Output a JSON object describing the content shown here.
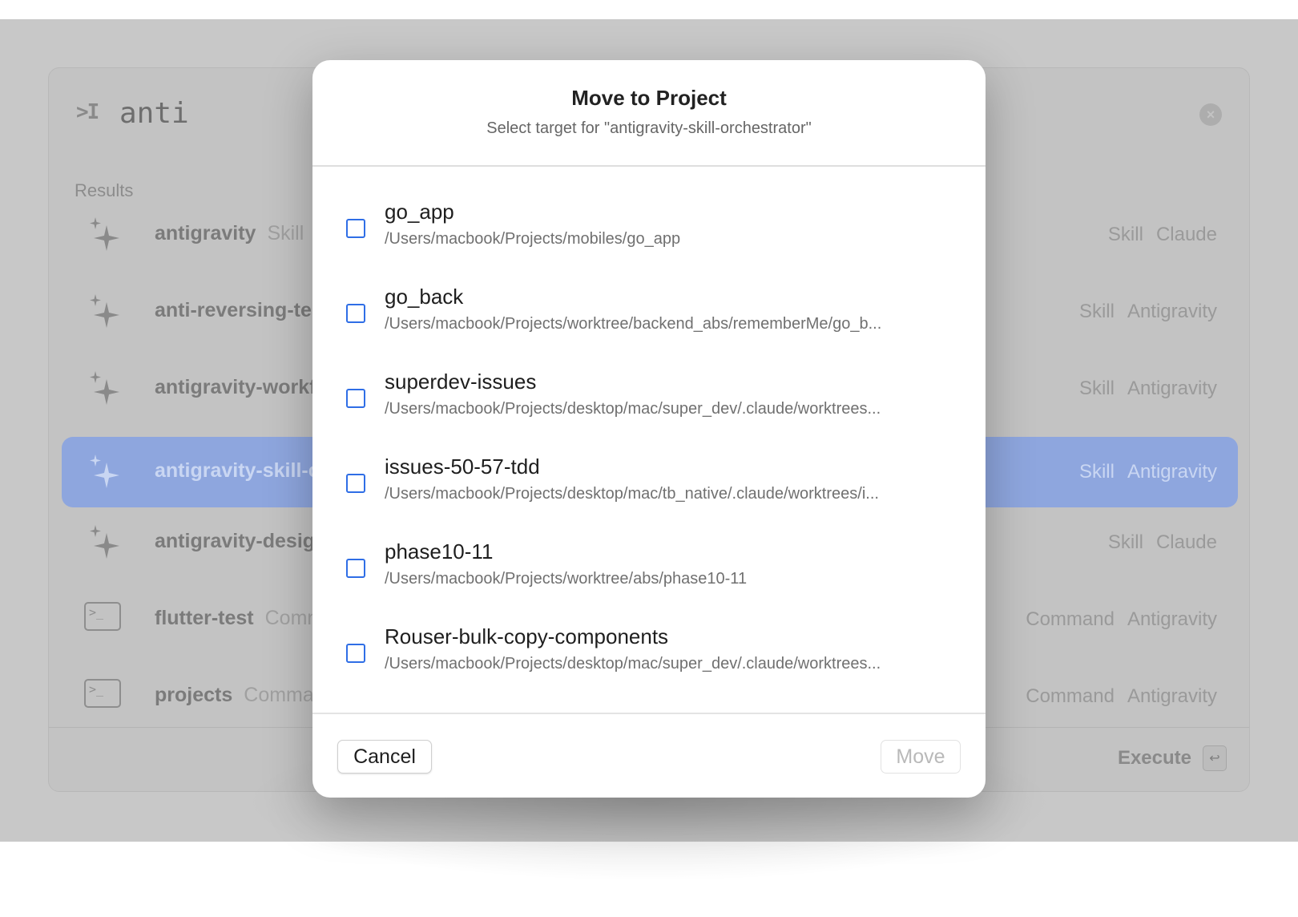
{
  "launcher": {
    "prompt_symbol": ">I",
    "query": "anti",
    "clear_symbol": "×",
    "results_label": "Results",
    "rows": [
      {
        "name": "antigravity",
        "kind": "Skill",
        "tag1": "Skill",
        "tag2": "Claude",
        "icon": "sparkle-icon",
        "selected": false
      },
      {
        "name": "anti-reversing-te",
        "kind": "",
        "tag1": "Skill",
        "tag2": "Antigravity",
        "icon": "sparkle-icon",
        "selected": false
      },
      {
        "name": "antigravity-workf",
        "kind": "",
        "tag1": "Skill",
        "tag2": "Antigravity",
        "icon": "sparkle-icon",
        "selected": false
      },
      {
        "name": "antigravity-skill-c",
        "kind": "",
        "tag1": "Skill",
        "tag2": "Antigravity",
        "icon": "sparkle-icon",
        "selected": true
      },
      {
        "name": "antigravity-desig",
        "kind": "",
        "tag1": "Skill",
        "tag2": "Claude",
        "icon": "sparkle-icon",
        "selected": false
      },
      {
        "name": "flutter-test",
        "kind": "Comn",
        "tag1": "Command",
        "tag2": "Antigravity",
        "icon": "terminal-icon",
        "selected": false
      },
      {
        "name": "projects",
        "kind": "Commar",
        "tag1": "Command",
        "tag2": "Antigravity",
        "icon": "terminal-icon",
        "selected": false
      }
    ],
    "execute_label": "Execute",
    "execute_key": "↩"
  },
  "modal": {
    "title": "Move to Project",
    "subtitle": "Select target for \"antigravity-skill-orchestrator\"",
    "projects": [
      {
        "name": "go_app",
        "path": "/Users/macbook/Projects/mobiles/go_app"
      },
      {
        "name": "go_back",
        "path": "/Users/macbook/Projects/worktree/backend_abs/rememberMe/go_b..."
      },
      {
        "name": "superdev-issues",
        "path": "/Users/macbook/Projects/desktop/mac/super_dev/.claude/worktrees..."
      },
      {
        "name": "issues-50-57-tdd",
        "path": "/Users/macbook/Projects/desktop/mac/tb_native/.claude/worktrees/i..."
      },
      {
        "name": "phase10-11",
        "path": "/Users/macbook/Projects/worktree/abs/phase10-11"
      },
      {
        "name": "Rouser-bulk-copy-components",
        "path": "/Users/macbook/Projects/desktop/mac/super_dev/.claude/worktrees..."
      }
    ],
    "cancel_label": "Cancel",
    "move_label": "Move"
  }
}
